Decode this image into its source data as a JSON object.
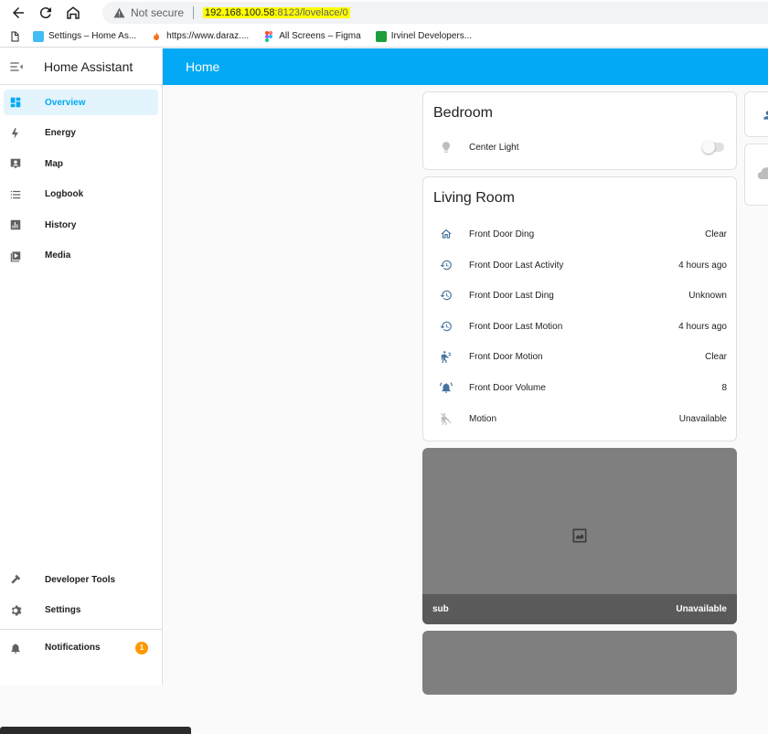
{
  "browser": {
    "security_label": "Not secure",
    "url_host": "192.168.100.58",
    "url_rest": ":8123/lovelace/0",
    "bookmarks": [
      {
        "label": "Settings – Home As..."
      },
      {
        "label": "https://www.daraz...."
      },
      {
        "label": "All Screens – Figma"
      },
      {
        "label": "Irvinel Developers..."
      }
    ]
  },
  "sidebar": {
    "title": "Home Assistant",
    "items": [
      {
        "label": "Overview",
        "icon": "dashboard-icon"
      },
      {
        "label": "Energy",
        "icon": "lightning-icon"
      },
      {
        "label": "Map",
        "icon": "map-icon"
      },
      {
        "label": "Logbook",
        "icon": "list-icon"
      },
      {
        "label": "History",
        "icon": "chart-icon"
      },
      {
        "label": "Media",
        "icon": "media-icon"
      }
    ],
    "bottom": [
      {
        "label": "Developer Tools",
        "icon": "hammer-icon"
      },
      {
        "label": "Settings",
        "icon": "gear-icon"
      }
    ],
    "notifications": {
      "label": "Notifications",
      "count": "1"
    }
  },
  "header": {
    "title": "Home"
  },
  "cards": {
    "bedroom": {
      "title": "Bedroom",
      "rows": [
        {
          "name": "Center Light",
          "icon": "bulb-icon"
        }
      ]
    },
    "living_room": {
      "title": "Living Room",
      "rows": [
        {
          "name": "Front Door Ding",
          "state": "Clear",
          "icon": "home-icon"
        },
        {
          "name": "Front Door Last Activity",
          "state": "4 hours ago",
          "icon": "history-icon"
        },
        {
          "name": "Front Door Last Ding",
          "state": "Unknown",
          "icon": "history-icon"
        },
        {
          "name": "Front Door Last Motion",
          "state": "4 hours ago",
          "icon": "history-icon"
        },
        {
          "name": "Front Door Motion",
          "state": "Clear",
          "icon": "motion-icon"
        },
        {
          "name": "Front Door Volume",
          "state": "8",
          "icon": "bell-icon"
        },
        {
          "name": "Motion",
          "state": "Unavailable",
          "icon": "motion-off-icon"
        }
      ]
    },
    "picture": {
      "name": "sub",
      "state": "Unavailable"
    }
  },
  "colors": {
    "accent": "#03a9f4",
    "icon": "#44739e",
    "badge": "#ff9800"
  }
}
